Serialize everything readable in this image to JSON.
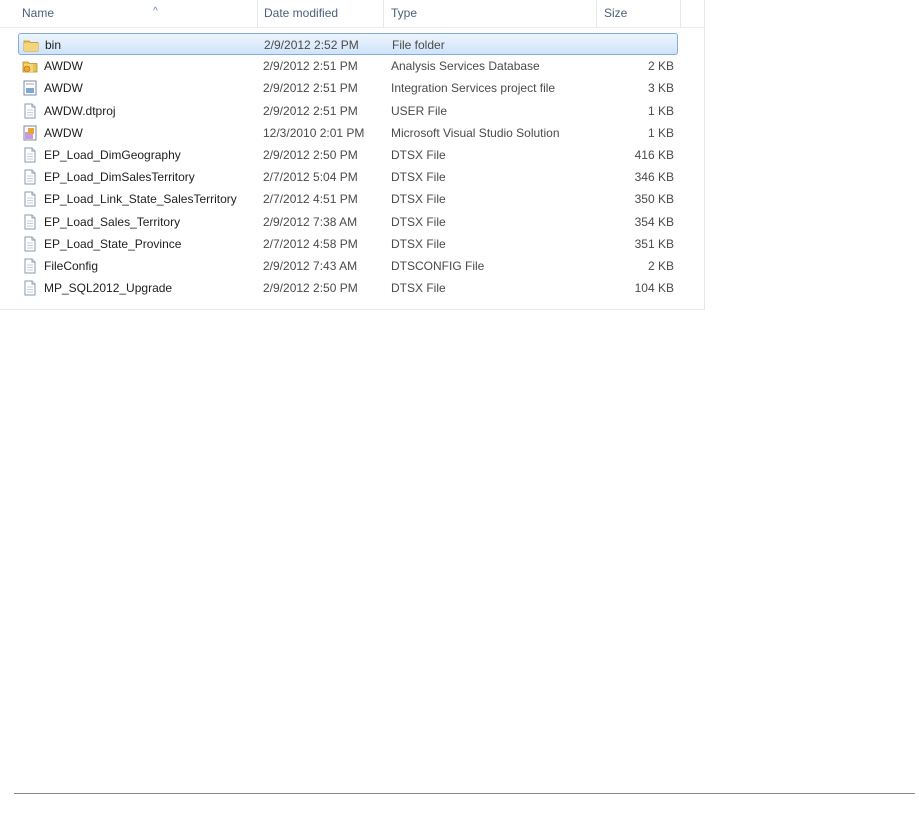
{
  "columns": {
    "name": "Name",
    "date": "Date modified",
    "type": "Type",
    "size": "Size"
  },
  "files": [
    {
      "name": "bin",
      "date": "2/9/2012 2:52 PM",
      "type": "File folder",
      "size": "",
      "icon": "folder-icon",
      "selected": true
    },
    {
      "name": "AWDW",
      "date": "2/9/2012 2:51 PM",
      "type": "Analysis Services Database",
      "size": "2 KB",
      "icon": "analysis-services-database-icon"
    },
    {
      "name": "AWDW",
      "date": "2/9/2012 2:51 PM",
      "type": "Integration Services project file",
      "size": "3 KB",
      "icon": "integration-services-project-icon"
    },
    {
      "name": "AWDW.dtproj",
      "date": "2/9/2012 2:51 PM",
      "type": "USER File",
      "size": "1 KB",
      "icon": "generic-file-icon"
    },
    {
      "name": "AWDW",
      "date": "12/3/2010 2:01 PM",
      "type": "Microsoft Visual Studio Solution",
      "size": "1 KB",
      "icon": "visual-studio-solution-icon"
    },
    {
      "name": "EP_Load_DimGeography",
      "date": "2/9/2012 2:50 PM",
      "type": "DTSX File",
      "size": "416 KB",
      "icon": "generic-file-icon"
    },
    {
      "name": "EP_Load_DimSalesTerritory",
      "date": "2/7/2012 5:04 PM",
      "type": "DTSX File",
      "size": "346 KB",
      "icon": "generic-file-icon"
    },
    {
      "name": "EP_Load_Link_State_SalesTerritory",
      "date": "2/7/2012 4:51 PM",
      "type": "DTSX File",
      "size": "350 KB",
      "icon": "generic-file-icon"
    },
    {
      "name": "EP_Load_Sales_Territory",
      "date": "2/9/2012 7:38 AM",
      "type": "DTSX File",
      "size": "354 KB",
      "icon": "generic-file-icon"
    },
    {
      "name": "EP_Load_State_Province",
      "date": "2/7/2012 4:58 PM",
      "type": "DTSX File",
      "size": "351 KB",
      "icon": "generic-file-icon"
    },
    {
      "name": "FileConfig",
      "date": "2/9/2012 7:43 AM",
      "type": "DTSCONFIG File",
      "size": "2 KB",
      "icon": "generic-file-icon"
    },
    {
      "name": "MP_SQL2012_Upgrade",
      "date": "2/9/2012 2:50 PM",
      "type": "DTSX File",
      "size": "104 KB",
      "icon": "generic-file-icon"
    }
  ]
}
